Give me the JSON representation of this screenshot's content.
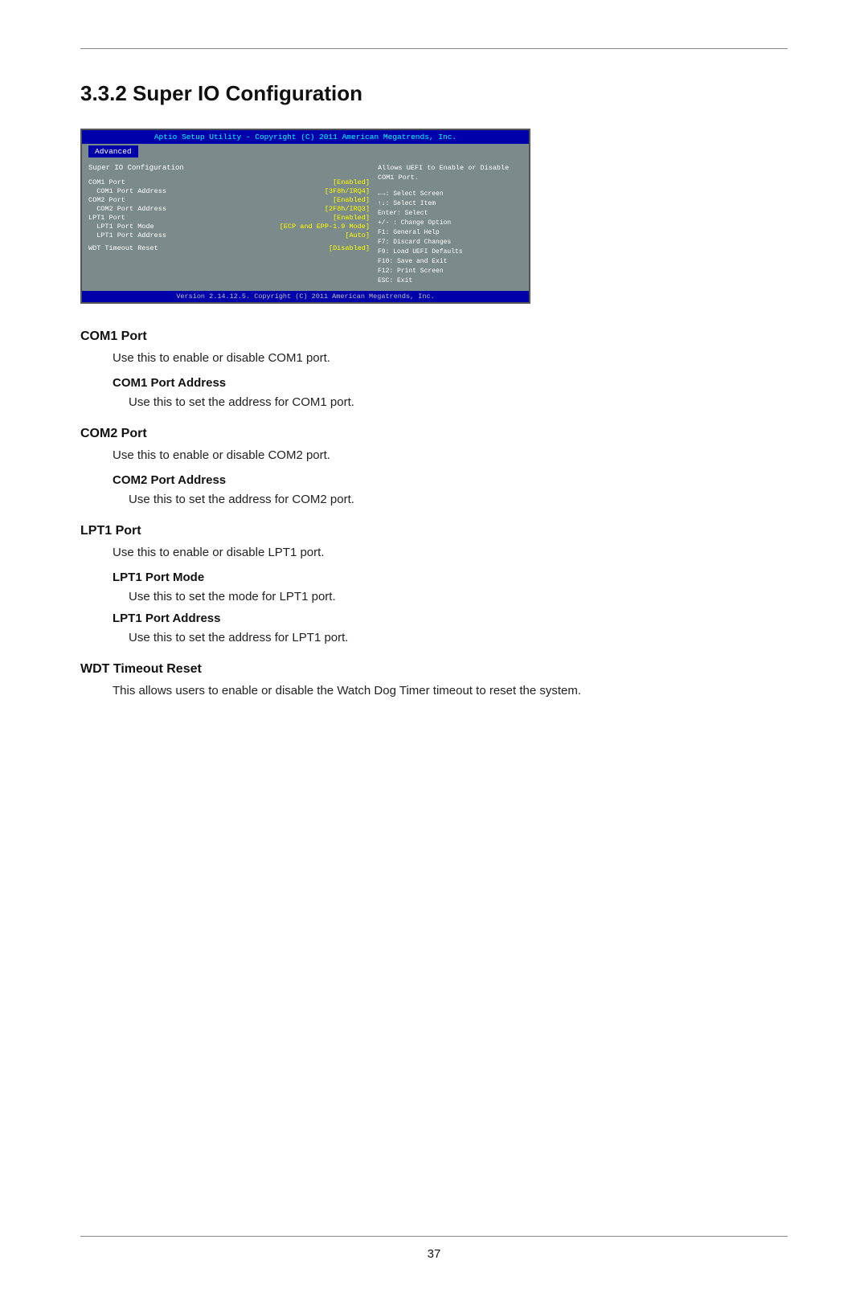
{
  "page": {
    "top_rule": true,
    "bottom_rule": true,
    "page_number": "37"
  },
  "section": {
    "title": "3.3.2  Super IO Configuration"
  },
  "bios": {
    "header_text": "Aptio Setup Utility - Copyright (C) 2011 American Megatrends, Inc.",
    "nav_tab": "Advanced",
    "left_title": "Super IO Configuration",
    "right_help_title": "Allows UEFI to Enable or Disable COM1 Port.",
    "items": [
      {
        "key": "COM1 Port",
        "val": "[Enabled]"
      },
      {
        "key": "COM1 Port Address",
        "val": "[3F8h/IRQ4]"
      },
      {
        "key": "COM2 Port",
        "val": "[Enabled]"
      },
      {
        "key": "COM2 Port Address",
        "val": "[2F8h/IRQ3]"
      },
      {
        "key": "LPT1 Port",
        "val": "[Enabled]"
      },
      {
        "key": "LPT1 Port Mode",
        "val": "[ECP and EPP-1.9 Mode]"
      },
      {
        "key": "LPT1 Port Address",
        "val": "[Auto]"
      },
      {
        "key": "WDT Timeout Reset",
        "val": "[Disabled]"
      }
    ],
    "legend": [
      "←→: Select Screen",
      "↑↓: Select Item",
      "Enter: Select",
      "+/- : Change Option",
      "F1: General Help",
      "F7: Discard Changes",
      "F9: Load UEFI Defaults",
      "F10: Save and Exit",
      "F12: Print Screen",
      "ESC: Exit"
    ],
    "footer_text": "Version 2.14.12.5. Copyright (C) 2011 American Megatrends, Inc."
  },
  "content": {
    "com1_port_heading": "COM1 Port",
    "com1_port_text": "Use this to enable or disable COM1 port.",
    "com1_port_address_heading": "COM1 Port Address",
    "com1_port_address_text": "Use this to set the address for COM1 port.",
    "com2_port_heading": "COM2 Port",
    "com2_port_text": "Use this to enable or disable COM2 port.",
    "com2_port_address_heading": "COM2 Port Address",
    "com2_port_address_text": "Use this to set the address for COM2 port.",
    "lpt1_port_heading": "LPT1 Port",
    "lpt1_port_text": "Use this to enable or disable LPT1 port.",
    "lpt1_port_mode_heading": "LPT1 Port Mode",
    "lpt1_port_mode_text": "Use this to set the mode for LPT1 port.",
    "lpt1_port_address_heading": "LPT1 Port Address",
    "lpt1_port_address_text": "Use this to set the address for LPT1 port.",
    "wdt_heading": "WDT Timeout Reset",
    "wdt_text": "This allows users to enable or disable the Watch Dog Timer timeout to reset the system."
  }
}
